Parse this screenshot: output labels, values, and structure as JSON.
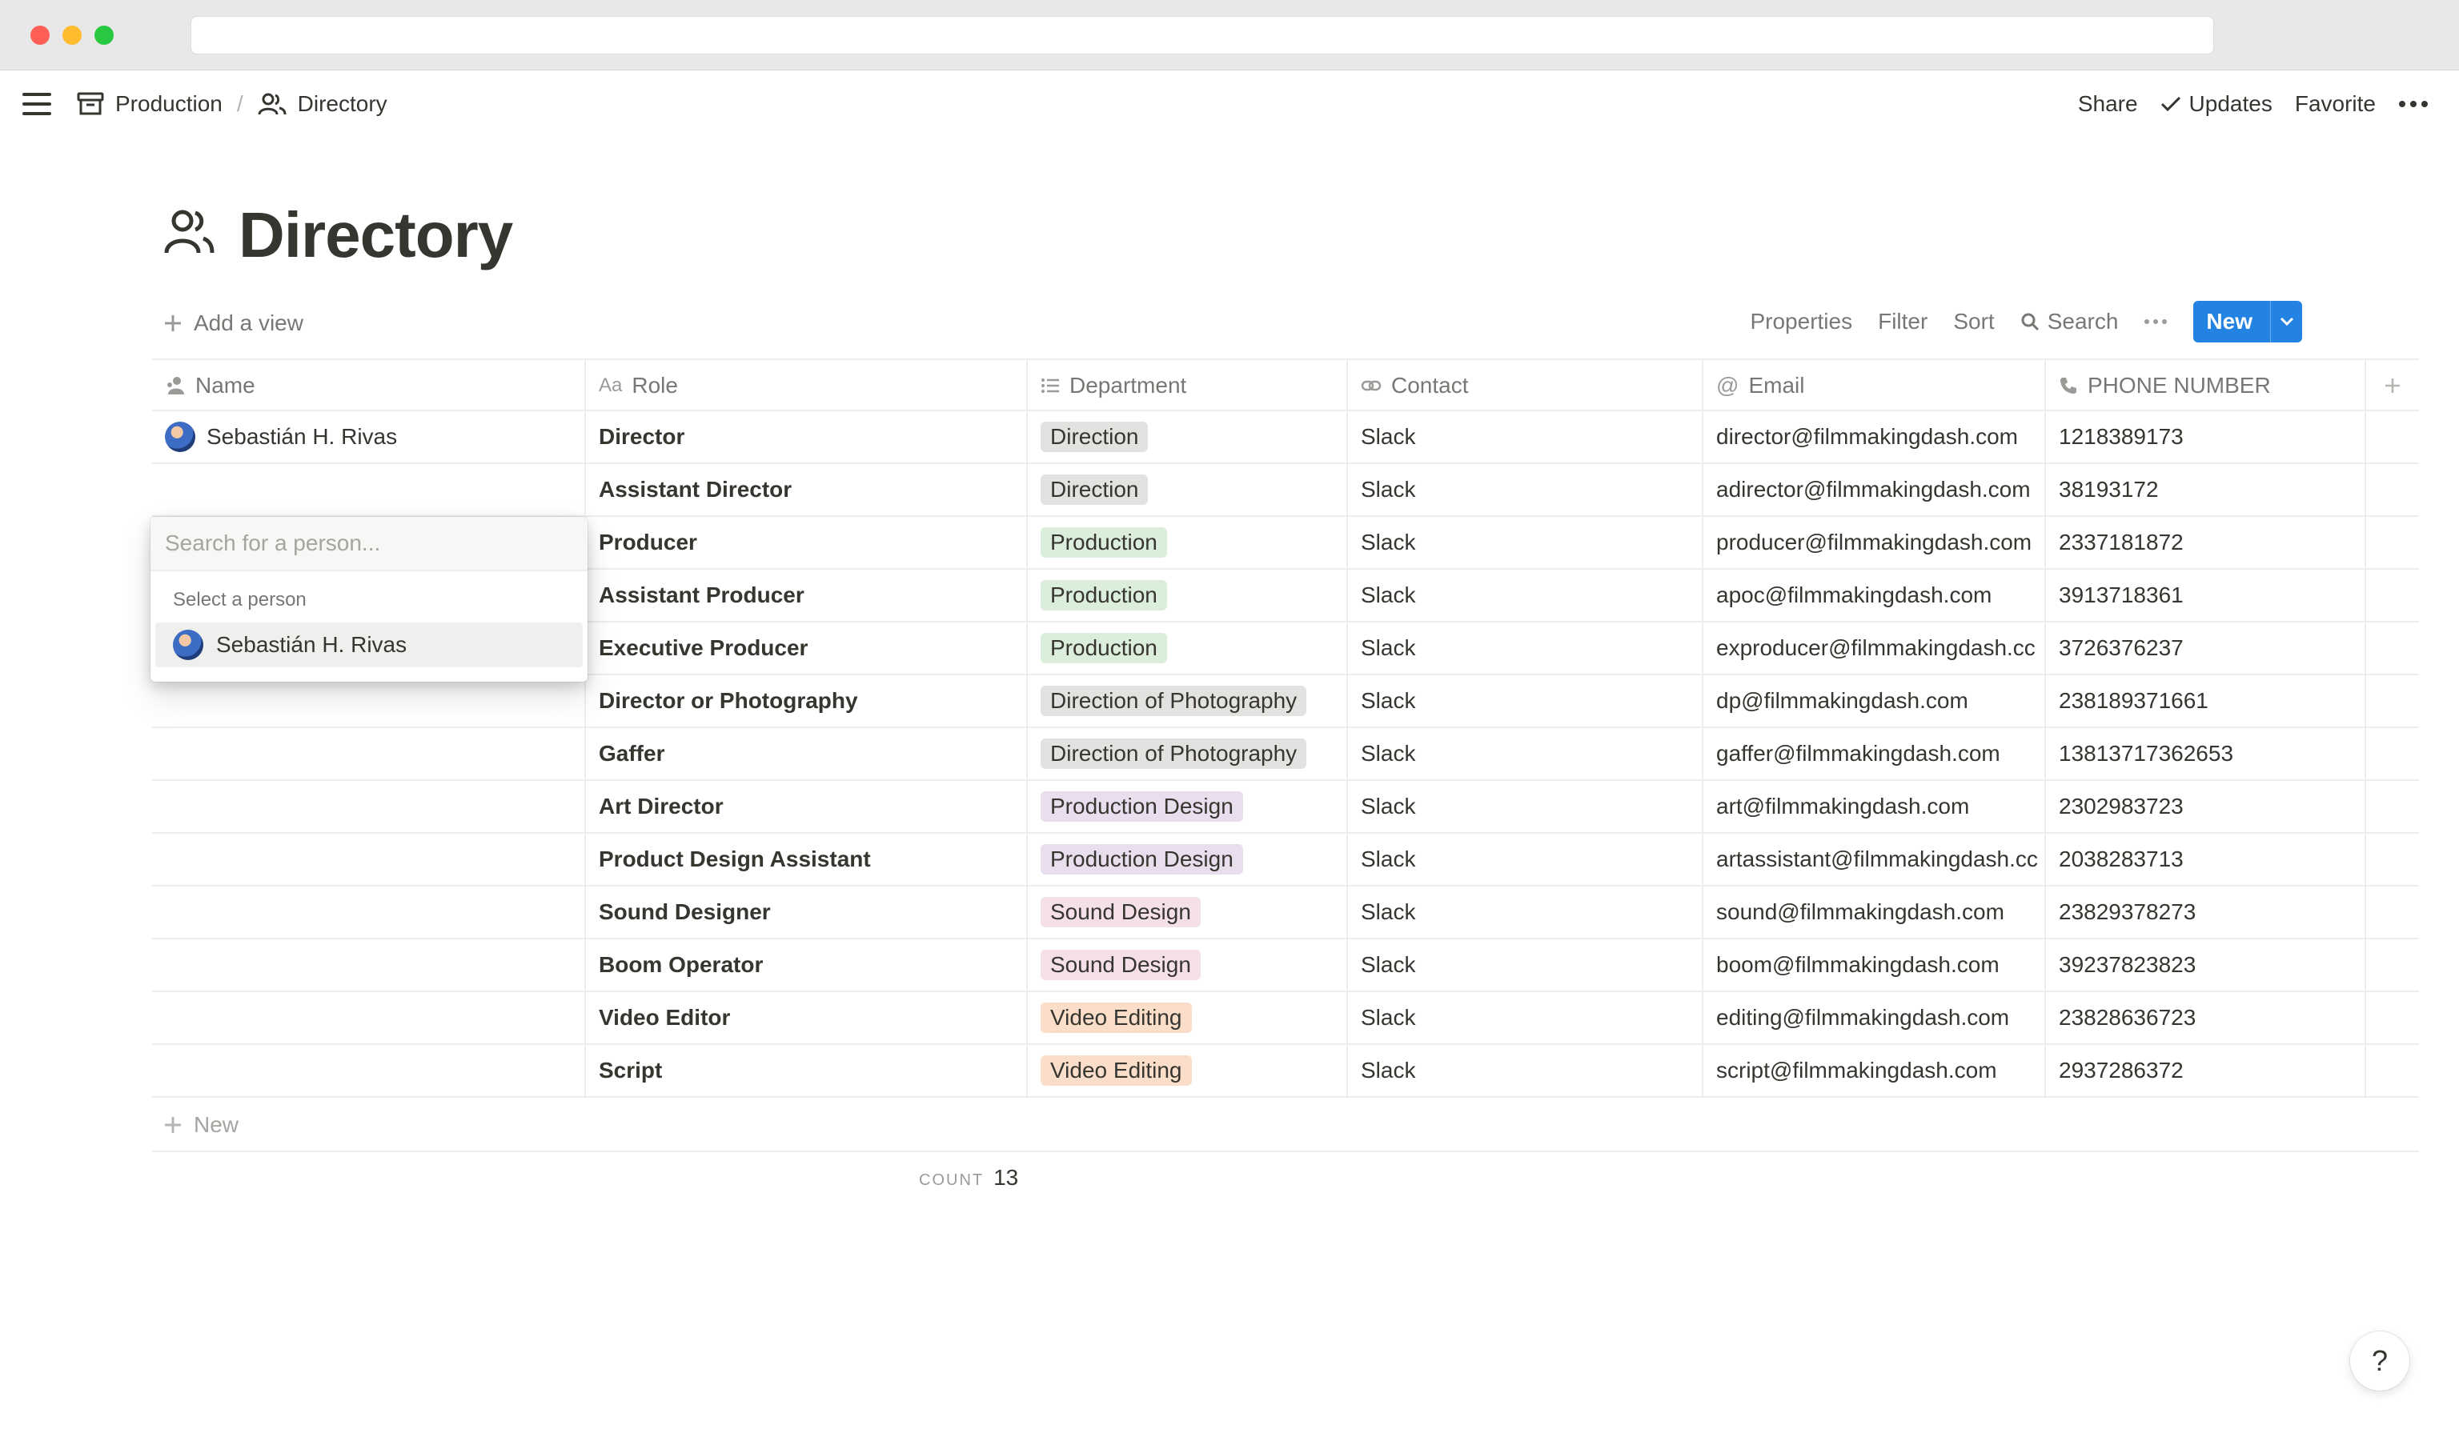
{
  "breadcrumb": {
    "parent": "Production",
    "current": "Directory"
  },
  "top_actions": {
    "share": "Share",
    "updates": "Updates",
    "favorite": "Favorite"
  },
  "page": {
    "title": "Directory"
  },
  "toolbar": {
    "add_view": "Add a view",
    "properties": "Properties",
    "filter": "Filter",
    "sort": "Sort",
    "search": "Search",
    "new": "New"
  },
  "columns": {
    "name": "Name",
    "role": "Role",
    "department": "Department",
    "contact": "Contact",
    "email": "Email",
    "phone": "PHONE NUMBER"
  },
  "rows": [
    {
      "name": "Sebastián H. Rivas",
      "role": "Director",
      "department": "Direction",
      "contact": "Slack",
      "email": "director@filmmakingdash.com",
      "phone": "1218389173"
    },
    {
      "name": "",
      "role": "Assistant Director",
      "department": "Direction",
      "contact": "Slack",
      "email": "adirector@filmmakingdash.com",
      "phone": "38193172"
    },
    {
      "name": "",
      "role": "Producer",
      "department": "Production",
      "contact": "Slack",
      "email": "producer@filmmakingdash.com",
      "phone": "2337181872"
    },
    {
      "name": "",
      "role": "Assistant Producer",
      "department": "Production",
      "contact": "Slack",
      "email": "apoc@filmmakingdash.com",
      "phone": "3913718361"
    },
    {
      "name": "",
      "role": "Executive Producer",
      "department": "Production",
      "contact": "Slack",
      "email": "exproducer@filmmakingdash.cc",
      "phone": "3726376237"
    },
    {
      "name": "",
      "role": "Director or Photography",
      "department": "Direction of Photography",
      "contact": "Slack",
      "email": "dp@filmmakingdash.com",
      "phone": "238189371661"
    },
    {
      "name": "",
      "role": "Gaffer",
      "department": "Direction of Photography",
      "contact": "Slack",
      "email": "gaffer@filmmakingdash.com",
      "phone": "13813717362653"
    },
    {
      "name": "",
      "role": "Art Director",
      "department": "Production Design",
      "contact": "Slack",
      "email": "art@filmmakingdash.com",
      "phone": "2302983723"
    },
    {
      "name": "",
      "role": "Product Design Assistant",
      "department": "Production Design",
      "contact": "Slack",
      "email": "artassistant@filmmakingdash.cc",
      "phone": "2038283713"
    },
    {
      "name": "",
      "role": "Sound Designer",
      "department": "Sound Design",
      "contact": "Slack",
      "email": "sound@filmmakingdash.com",
      "phone": "23829378273"
    },
    {
      "name": "",
      "role": "Boom Operator",
      "department": "Sound Design",
      "contact": "Slack",
      "email": "boom@filmmakingdash.com",
      "phone": "39237823823"
    },
    {
      "name": "",
      "role": "Video Editor",
      "department": "Video Editing",
      "contact": "Slack",
      "email": "editing@filmmakingdash.com",
      "phone": "23828636723"
    },
    {
      "name": "",
      "role": "Script",
      "department": "Video Editing",
      "contact": "Slack",
      "email": "script@filmmakingdash.com",
      "phone": "2937286372"
    }
  ],
  "department_colors": {
    "Direction": "#e3e2e0",
    "Production": "#dbeddb",
    "Direction of Photography": "#e3e2e0",
    "Production Design": "#e8deee",
    "Sound Design": "#f5e0e9",
    "Video Editing": "#fadec9"
  },
  "footer": {
    "add_row": "New",
    "count_label": "COUNT",
    "count_value": "13"
  },
  "person_picker": {
    "placeholder": "Search for a person...",
    "caption": "Select a person",
    "option": "Sebastián H. Rivas"
  },
  "help": "?",
  "colors": {
    "accent": "#2383e2",
    "text": "#37352f",
    "muted": "#787774"
  }
}
